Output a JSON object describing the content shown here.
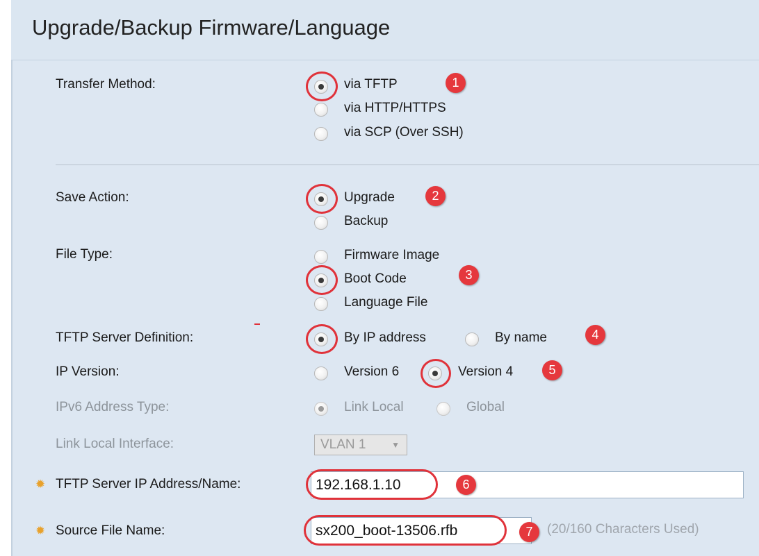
{
  "page": {
    "title": "Upgrade/Backup Firmware/Language"
  },
  "transfer_method": {
    "label": "Transfer Method:",
    "options": [
      "via TFTP",
      "via HTTP/HTTPS",
      "via SCP (Over SSH)"
    ],
    "selected": "via TFTP"
  },
  "save_action": {
    "label": "Save Action:",
    "options": [
      "Upgrade",
      "Backup"
    ],
    "selected": "Upgrade"
  },
  "file_type": {
    "label": "File Type:",
    "options": [
      "Firmware Image",
      "Boot Code",
      "Language File"
    ],
    "selected": "Boot Code"
  },
  "tftp_server_definition": {
    "label": "TFTP Server Definition:",
    "options": [
      "By IP address",
      "By name"
    ],
    "selected": "By IP address"
  },
  "ip_version": {
    "label": "IP Version:",
    "options": [
      "Version 6",
      "Version 4"
    ],
    "selected": "Version 4"
  },
  "ipv6_address_type": {
    "label": "IPv6 Address Type:",
    "options": [
      "Link Local",
      "Global"
    ],
    "selected": "Link Local",
    "disabled": true
  },
  "link_local_interface": {
    "label": "Link Local Interface:",
    "value": "VLAN 1",
    "disabled": true
  },
  "tftp_server_address": {
    "label": "TFTP Server IP Address/Name:",
    "value": "192.168.1.10",
    "required": true
  },
  "source_file_name": {
    "label": "Source File Name:",
    "value": "sx200_boot-13506.rfb",
    "hint": "(20/160 Characters Used)",
    "required": true
  },
  "annotations": [
    "1",
    "2",
    "3",
    "4",
    "5",
    "6",
    "7"
  ],
  "colors": {
    "annotation": "#e5383d",
    "panel": "#dde7f2",
    "required_star": "#e8a12b"
  },
  "icons": {
    "required": "asterisk-icon",
    "dropdown": "triangle-down-icon"
  }
}
